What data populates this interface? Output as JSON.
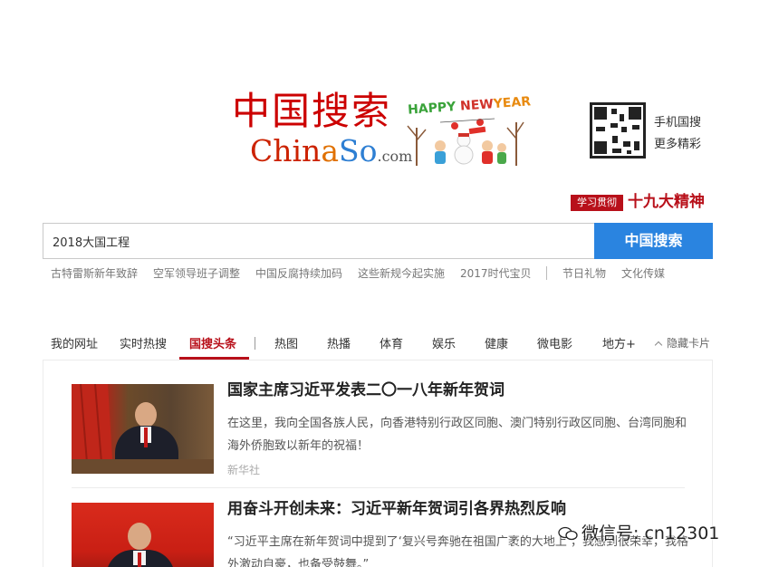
{
  "logo": {
    "cn": "中国搜索",
    "en_part1": "Chin",
    "en_part2": "a",
    "en_part3": "So",
    "en_part4": ".com"
  },
  "festive": {
    "happy": "HAPPY",
    "new": "NEW",
    "year": "YEAR"
  },
  "qr": {
    "line1": "手机国搜",
    "line2": "更多精彩"
  },
  "banner": {
    "badge": "学习贯彻",
    "title": "十九大精神"
  },
  "search": {
    "value": "2018大国工程",
    "button": "中国搜索"
  },
  "hot_links": [
    "古特雷斯新年致辞",
    "空军领导班子调整",
    "中国反腐持续加码",
    "这些新规今起实施",
    "2017时代宝贝",
    "节日礼物",
    "文化传媒"
  ],
  "tabs": [
    "我的网址",
    "实时热搜",
    "国搜头条",
    "热图",
    "热播",
    "体育",
    "娱乐",
    "健康",
    "微电影",
    "地方+"
  ],
  "hide_cards": "隐藏卡片",
  "active_tab": "国搜头条",
  "news": [
    {
      "title": "国家主席习近平发表二〇一八年新年贺词",
      "desc": "在这里，我向全国各族人民，向香港特别行政区同胞、澳门特别行政区同胞、台湾同胞和海外侨胞致以新年的祝福！",
      "source": "新华社"
    },
    {
      "title": "用奋斗开创未来：习近平新年贺词引各界热烈反响",
      "desc": "“习近平主席在新年贺词中提到了‘复兴号奔驰在祖国广袤的大地上’，我感到很荣幸，我格外激动自豪，也备受鼓舞。”",
      "source": ""
    }
  ],
  "watermark": "微信号: cn12301",
  "colors": {
    "brand_red": "#b8101a",
    "search_blue": "#2a84e0"
  }
}
